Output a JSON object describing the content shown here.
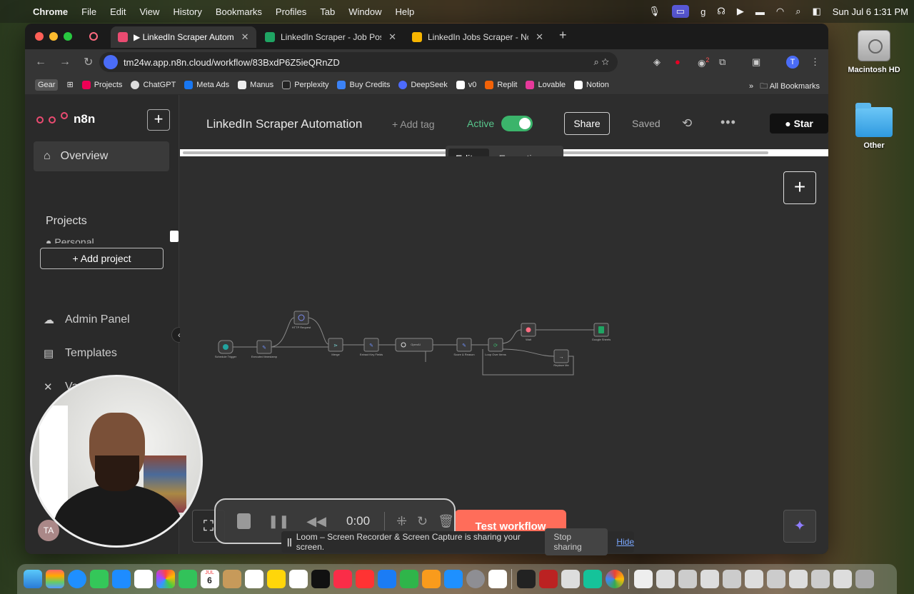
{
  "menubar": {
    "app": "Chrome",
    "items": [
      "File",
      "Edit",
      "View",
      "History",
      "Bookmarks",
      "Profiles",
      "Tab",
      "Window",
      "Help"
    ],
    "datetime": "Sun Jul 6  1:31 PM"
  },
  "desktop": {
    "icons": [
      {
        "label": "Macintosh HD",
        "icon": "hard-drive-icon"
      },
      {
        "label": "Other",
        "icon": "folder-icon"
      }
    ]
  },
  "browser": {
    "tabs": [
      {
        "title": "▶ LinkedIn Scraper Autom",
        "icon": "n8n-icon",
        "active": true
      },
      {
        "title": "LinkedIn Scraper - Job Postin",
        "icon": "google-sheets-icon",
        "active": false
      },
      {
        "title": "LinkedIn Jobs Scraper - No C",
        "icon": "apify-icon",
        "active": false
      }
    ],
    "url": "tm24w.app.n8n.cloud/workflow/83BxdP6Z5ieQRnZD",
    "profile_initial": "T",
    "extension_badge": "2",
    "bookmarks": [
      "Gear",
      "Projects",
      "ChatGPT",
      "Meta Ads",
      "Manus",
      "Perplexity",
      "Buy Credits",
      "DeepSeek",
      "v0",
      "Replit",
      "Lovable",
      "Notion"
    ],
    "all_bookmarks": "All Bookmarks"
  },
  "n8n": {
    "logo": "n8n",
    "sidebar": {
      "overview": "Overview",
      "projects_heading": "Projects",
      "personal": "Personal",
      "add_project": "+ Add project",
      "admin_panel": "Admin Panel",
      "templates": "Templates",
      "variables": "Va",
      "user_initials": "TA"
    },
    "header": {
      "workflow_name": "LinkedIn Scraper Automation",
      "add_tag": "+ Add tag",
      "active_label": "Active",
      "active": true,
      "share": "Share",
      "saved": "Saved",
      "star": "Star"
    },
    "view_tabs": [
      "Editor",
      "Executions"
    ],
    "active_view": "Editor",
    "canvas": {
      "test_workflow": "Test workflow",
      "nodes": [
        {
          "label": "Schedule Trigger"
        },
        {
          "label": "Executed timestamp"
        },
        {
          "label": "HTTP Request"
        },
        {
          "label": "Merge"
        },
        {
          "label": "Extract Key Fields"
        },
        {
          "label": "OpenAI"
        },
        {
          "label": "Score & Reason"
        },
        {
          "label": "Loop Over Items"
        },
        {
          "label": "Wait"
        },
        {
          "label": "Replace Me"
        },
        {
          "label": "Google Sheets"
        }
      ]
    }
  },
  "loom": {
    "timer": "0:00",
    "share_notice": "Loom – Screen Recorder & Screen Capture is sharing your screen.",
    "stop_sharing": "Stop sharing",
    "hide": "Hide"
  },
  "dock": {
    "calendar_month": "JUL",
    "calendar_day": "6",
    "badge": "2"
  }
}
